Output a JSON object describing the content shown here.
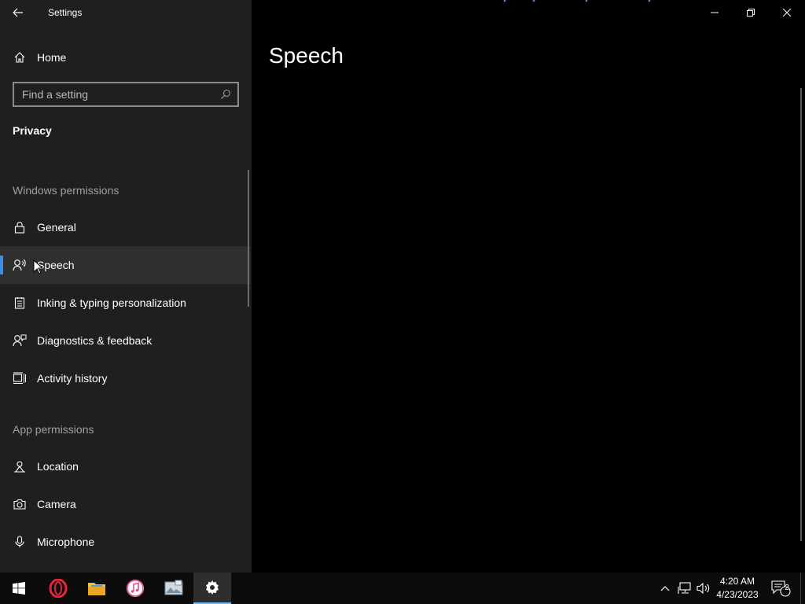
{
  "window": {
    "title": "Settings"
  },
  "sidebar": {
    "home_label": "Home",
    "search_placeholder": "Find a setting",
    "section_title": "Privacy",
    "windows_permissions_header": "Windows permissions",
    "windows_permissions": [
      {
        "label": "General",
        "icon": "lock-icon",
        "selected": false
      },
      {
        "label": "Speech",
        "icon": "speech-icon",
        "selected": true
      },
      {
        "label": "Inking & typing personalization",
        "icon": "inking-icon",
        "selected": false
      },
      {
        "label": "Diagnostics & feedback",
        "icon": "diagnostics-icon",
        "selected": false
      },
      {
        "label": "Activity history",
        "icon": "activity-history-icon",
        "selected": false
      }
    ],
    "app_permissions_header": "App permissions",
    "app_permissions": [
      {
        "label": "Location",
        "icon": "location-icon"
      },
      {
        "label": "Camera",
        "icon": "camera-icon"
      },
      {
        "label": "Microphone",
        "icon": "microphone-icon"
      }
    ]
  },
  "content": {
    "page_title": "Speech"
  },
  "taskbar": {
    "apps": [
      "start-icon",
      "opera-icon",
      "file-explorer-icon",
      "itunes-icon",
      "photo-app-icon",
      "settings-icon"
    ],
    "active_app": "settings-icon",
    "clock_time": "4:20 AM",
    "clock_date": "4/23/2023",
    "notification_count": "2"
  },
  "colors": {
    "accent": "#3a8ee6",
    "sidebar_bg": "#1f1f1f",
    "content_bg": "#000000",
    "selected_bg": "#2f2f2f"
  }
}
